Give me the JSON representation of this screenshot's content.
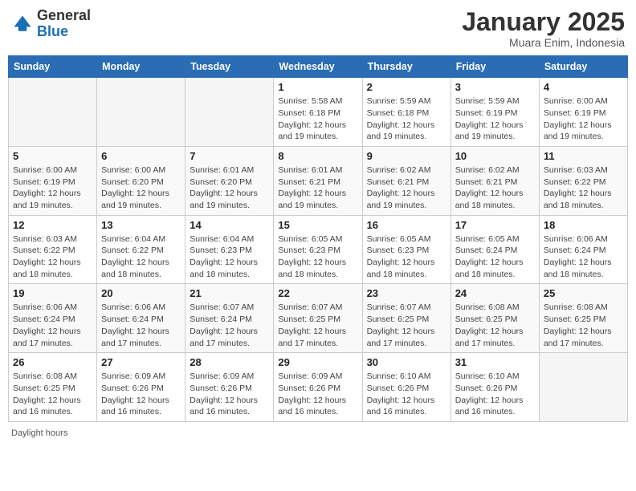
{
  "header": {
    "logo_general": "General",
    "logo_blue": "Blue",
    "month_title": "January 2025",
    "subtitle": "Muara Enim, Indonesia"
  },
  "days_of_week": [
    "Sunday",
    "Monday",
    "Tuesday",
    "Wednesday",
    "Thursday",
    "Friday",
    "Saturday"
  ],
  "weeks": [
    [
      {
        "day": "",
        "info": ""
      },
      {
        "day": "",
        "info": ""
      },
      {
        "day": "",
        "info": ""
      },
      {
        "day": "1",
        "info": "Sunrise: 5:58 AM\nSunset: 6:18 PM\nDaylight: 12 hours and 19 minutes."
      },
      {
        "day": "2",
        "info": "Sunrise: 5:59 AM\nSunset: 6:18 PM\nDaylight: 12 hours and 19 minutes."
      },
      {
        "day": "3",
        "info": "Sunrise: 5:59 AM\nSunset: 6:19 PM\nDaylight: 12 hours and 19 minutes."
      },
      {
        "day": "4",
        "info": "Sunrise: 6:00 AM\nSunset: 6:19 PM\nDaylight: 12 hours and 19 minutes."
      }
    ],
    [
      {
        "day": "5",
        "info": "Sunrise: 6:00 AM\nSunset: 6:19 PM\nDaylight: 12 hours and 19 minutes."
      },
      {
        "day": "6",
        "info": "Sunrise: 6:00 AM\nSunset: 6:20 PM\nDaylight: 12 hours and 19 minutes."
      },
      {
        "day": "7",
        "info": "Sunrise: 6:01 AM\nSunset: 6:20 PM\nDaylight: 12 hours and 19 minutes."
      },
      {
        "day": "8",
        "info": "Sunrise: 6:01 AM\nSunset: 6:21 PM\nDaylight: 12 hours and 19 minutes."
      },
      {
        "day": "9",
        "info": "Sunrise: 6:02 AM\nSunset: 6:21 PM\nDaylight: 12 hours and 19 minutes."
      },
      {
        "day": "10",
        "info": "Sunrise: 6:02 AM\nSunset: 6:21 PM\nDaylight: 12 hours and 18 minutes."
      },
      {
        "day": "11",
        "info": "Sunrise: 6:03 AM\nSunset: 6:22 PM\nDaylight: 12 hours and 18 minutes."
      }
    ],
    [
      {
        "day": "12",
        "info": "Sunrise: 6:03 AM\nSunset: 6:22 PM\nDaylight: 12 hours and 18 minutes."
      },
      {
        "day": "13",
        "info": "Sunrise: 6:04 AM\nSunset: 6:22 PM\nDaylight: 12 hours and 18 minutes."
      },
      {
        "day": "14",
        "info": "Sunrise: 6:04 AM\nSunset: 6:23 PM\nDaylight: 12 hours and 18 minutes."
      },
      {
        "day": "15",
        "info": "Sunrise: 6:05 AM\nSunset: 6:23 PM\nDaylight: 12 hours and 18 minutes."
      },
      {
        "day": "16",
        "info": "Sunrise: 6:05 AM\nSunset: 6:23 PM\nDaylight: 12 hours and 18 minutes."
      },
      {
        "day": "17",
        "info": "Sunrise: 6:05 AM\nSunset: 6:24 PM\nDaylight: 12 hours and 18 minutes."
      },
      {
        "day": "18",
        "info": "Sunrise: 6:06 AM\nSunset: 6:24 PM\nDaylight: 12 hours and 18 minutes."
      }
    ],
    [
      {
        "day": "19",
        "info": "Sunrise: 6:06 AM\nSunset: 6:24 PM\nDaylight: 12 hours and 17 minutes."
      },
      {
        "day": "20",
        "info": "Sunrise: 6:06 AM\nSunset: 6:24 PM\nDaylight: 12 hours and 17 minutes."
      },
      {
        "day": "21",
        "info": "Sunrise: 6:07 AM\nSunset: 6:24 PM\nDaylight: 12 hours and 17 minutes."
      },
      {
        "day": "22",
        "info": "Sunrise: 6:07 AM\nSunset: 6:25 PM\nDaylight: 12 hours and 17 minutes."
      },
      {
        "day": "23",
        "info": "Sunrise: 6:07 AM\nSunset: 6:25 PM\nDaylight: 12 hours and 17 minutes."
      },
      {
        "day": "24",
        "info": "Sunrise: 6:08 AM\nSunset: 6:25 PM\nDaylight: 12 hours and 17 minutes."
      },
      {
        "day": "25",
        "info": "Sunrise: 6:08 AM\nSunset: 6:25 PM\nDaylight: 12 hours and 17 minutes."
      }
    ],
    [
      {
        "day": "26",
        "info": "Sunrise: 6:08 AM\nSunset: 6:25 PM\nDaylight: 12 hours and 16 minutes."
      },
      {
        "day": "27",
        "info": "Sunrise: 6:09 AM\nSunset: 6:26 PM\nDaylight: 12 hours and 16 minutes."
      },
      {
        "day": "28",
        "info": "Sunrise: 6:09 AM\nSunset: 6:26 PM\nDaylight: 12 hours and 16 minutes."
      },
      {
        "day": "29",
        "info": "Sunrise: 6:09 AM\nSunset: 6:26 PM\nDaylight: 12 hours and 16 minutes."
      },
      {
        "day": "30",
        "info": "Sunrise: 6:10 AM\nSunset: 6:26 PM\nDaylight: 12 hours and 16 minutes."
      },
      {
        "day": "31",
        "info": "Sunrise: 6:10 AM\nSunset: 6:26 PM\nDaylight: 12 hours and 16 minutes."
      },
      {
        "day": "",
        "info": ""
      }
    ]
  ],
  "footer": {
    "daylight_label": "Daylight hours"
  }
}
